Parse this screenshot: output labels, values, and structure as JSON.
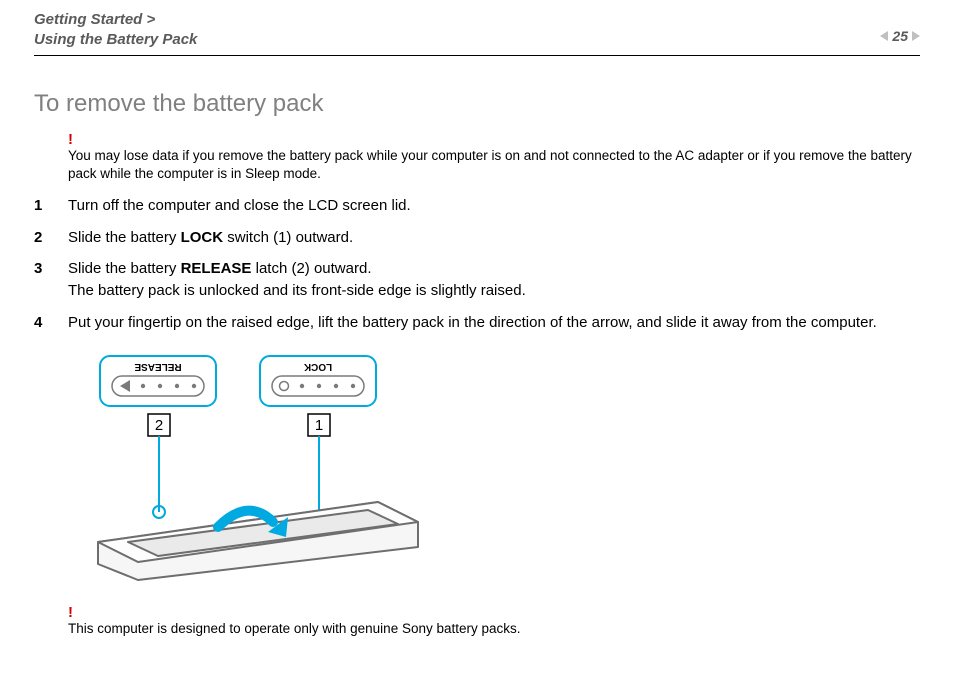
{
  "header": {
    "crumb1": "Getting Started >",
    "crumb2": "Using the Battery Pack",
    "page": "25"
  },
  "title": "To remove the battery pack",
  "warning_mark": "!",
  "warning_top": "You may lose data if you remove the battery pack while your computer is on and not connected to the AC adapter or if you remove the battery pack while the computer is in Sleep mode.",
  "steps": {
    "s1": "Turn off the computer and close the LCD screen lid.",
    "s2a": "Slide the battery ",
    "s2b": "LOCK",
    "s2c": " switch (1) outward.",
    "s3a": "Slide the battery ",
    "s3b": "RELEASE",
    "s3c": " latch (2) outward.",
    "s3d": "The battery pack is unlocked and its front-side edge is slightly raised.",
    "s4": "Put your fingertip on the raised edge, lift the battery pack in the direction of the arrow, and slide it away from the computer."
  },
  "diagram": {
    "label_release": "RELEASE",
    "label_lock": "LOCK",
    "callout_1": "1",
    "callout_2": "2"
  },
  "warning_bottom": "This computer is designed to operate only with genuine Sony battery packs."
}
